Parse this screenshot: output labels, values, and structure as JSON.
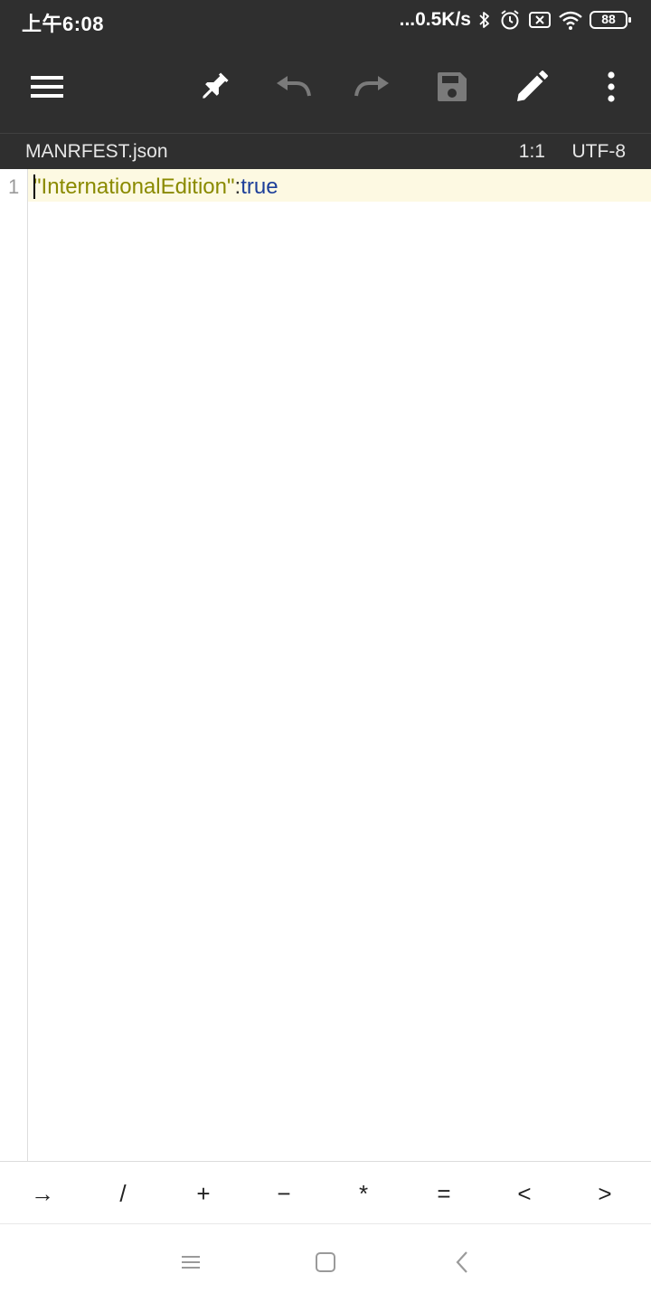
{
  "status": {
    "time": "上午6:08",
    "net_speed": "...0.5K/s",
    "battery": "88"
  },
  "toolbar": {
    "icons": [
      "menu-icon",
      "pin-icon",
      "undo-icon",
      "redo-icon",
      "save-icon",
      "edit-icon",
      "more-vert-icon"
    ],
    "colors": {
      "background": "#2f2f2f",
      "active_icon": "#ffffff",
      "disabled_icon": "#7a7a7a"
    }
  },
  "info": {
    "file_name": "MANRFEST.json",
    "cursor_position": "1:1",
    "encoding": "UTF-8"
  },
  "editor": {
    "lines": [
      {
        "number": "1",
        "key": "\"InternationalEdition\"",
        "colon": ":",
        "value": "true"
      }
    ],
    "colors": {
      "key": "#8a8a00",
      "value": "#1d3f9a",
      "current_line": "#fdf9e2"
    }
  },
  "symbols": [
    "→",
    "/",
    "+",
    "−",
    "*",
    "=",
    "<",
    ">"
  ],
  "navbar": {
    "icons": [
      "recents-icon",
      "home-icon",
      "back-icon"
    ]
  }
}
